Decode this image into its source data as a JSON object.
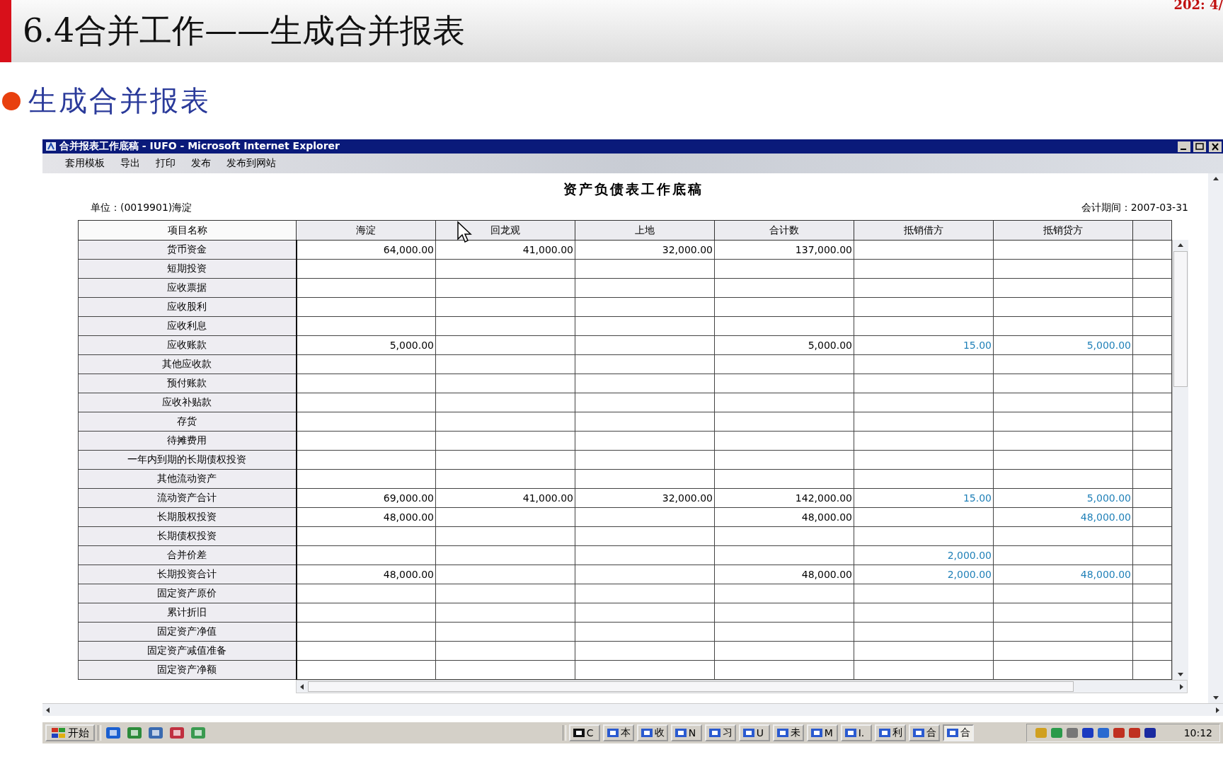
{
  "slide": {
    "title": "6.4合并工作——生成合并报表",
    "page_number": "202: 4/",
    "bullet": "生成合并报表"
  },
  "window": {
    "title": "合并报表工作底稿 - IUFO - Microsoft Internet Explorer"
  },
  "menu": [
    "套用模板",
    "导出",
    "打印",
    "发布",
    "发布到网站"
  ],
  "report": {
    "title": "资产负债表工作底稿",
    "unit": "单位：(0019901)海淀",
    "period": "会计期间：2007-03-31"
  },
  "table": {
    "name_header": "项目名称",
    "columns": [
      {
        "label": "海淀",
        "kind": "amount"
      },
      {
        "label": "回龙观",
        "kind": "amount"
      },
      {
        "label": "上地",
        "kind": "amount"
      },
      {
        "label": "合计数",
        "kind": "amount"
      },
      {
        "label": "抵销借方",
        "kind": "elimination"
      },
      {
        "label": "抵销贷方",
        "kind": "elimination"
      }
    ],
    "rows": [
      {
        "name": "货币资金",
        "cells": [
          "64,000.00",
          "41,000.00",
          "32,000.00",
          "137,000.00",
          null,
          null
        ]
      },
      {
        "name": "短期投资",
        "cells": [
          null,
          null,
          null,
          null,
          null,
          null
        ]
      },
      {
        "name": "应收票据",
        "cells": [
          null,
          null,
          null,
          null,
          null,
          null
        ]
      },
      {
        "name": "应收股利",
        "cells": [
          null,
          null,
          null,
          null,
          null,
          null
        ]
      },
      {
        "name": "应收利息",
        "cells": [
          null,
          null,
          null,
          null,
          null,
          null
        ]
      },
      {
        "name": "应收账款",
        "cells": [
          "5,000.00",
          null,
          null,
          "5,000.00",
          "15.00",
          "5,000.00"
        ]
      },
      {
        "name": "其他应收款",
        "cells": [
          null,
          null,
          null,
          null,
          null,
          null
        ]
      },
      {
        "name": "预付账款",
        "cells": [
          null,
          null,
          null,
          null,
          null,
          null
        ]
      },
      {
        "name": "应收补贴款",
        "cells": [
          null,
          null,
          null,
          null,
          null,
          null
        ]
      },
      {
        "name": "存货",
        "cells": [
          null,
          null,
          null,
          null,
          null,
          null
        ]
      },
      {
        "name": "待摊费用",
        "cells": [
          null,
          null,
          null,
          null,
          null,
          null
        ]
      },
      {
        "name": "一年内到期的长期债权投资",
        "cells": [
          null,
          null,
          null,
          null,
          null,
          null
        ]
      },
      {
        "name": "其他流动资产",
        "cells": [
          null,
          null,
          null,
          null,
          null,
          null
        ]
      },
      {
        "name": "流动资产合计",
        "cells": [
          "69,000.00",
          "41,000.00",
          "32,000.00",
          "142,000.00",
          "15.00",
          "5,000.00"
        ]
      },
      {
        "name": "长期股权投资",
        "cells": [
          "48,000.00",
          null,
          null,
          "48,000.00",
          null,
          "48,000.00"
        ]
      },
      {
        "name": "长期债权投资",
        "cells": [
          null,
          null,
          null,
          null,
          null,
          null
        ]
      },
      {
        "name": "合并价差",
        "cells": [
          null,
          null,
          null,
          null,
          "2,000.00",
          null
        ]
      },
      {
        "name": "长期投资合计",
        "cells": [
          "48,000.00",
          null,
          null,
          "48,000.00",
          "2,000.00",
          "48,000.00"
        ]
      },
      {
        "name": "固定资产原价",
        "cells": [
          null,
          null,
          null,
          null,
          null,
          null
        ]
      },
      {
        "name": "累计折旧",
        "cells": [
          null,
          null,
          null,
          null,
          null,
          null
        ]
      },
      {
        "name": "固定资产净值",
        "cells": [
          null,
          null,
          null,
          null,
          null,
          null
        ]
      },
      {
        "name": "固定资产减值准备",
        "cells": [
          null,
          null,
          null,
          null,
          null,
          null
        ]
      },
      {
        "name": "固定资产净额",
        "cells": [
          null,
          null,
          null,
          null,
          null,
          null
        ]
      }
    ]
  },
  "taskbar": {
    "start": "开始",
    "tasks": [
      {
        "label": "C",
        "selected": false
      },
      {
        "label": "本",
        "selected": false
      },
      {
        "label": "收",
        "selected": false
      },
      {
        "label": "N",
        "selected": false
      },
      {
        "label": "习",
        "selected": false
      },
      {
        "label": "U",
        "selected": false
      },
      {
        "label": "未",
        "selected": false
      },
      {
        "label": "M",
        "selected": false
      },
      {
        "label": "I.",
        "selected": false
      },
      {
        "label": "利",
        "selected": false
      },
      {
        "label": "合",
        "selected": false
      },
      {
        "label": "合",
        "selected": true
      }
    ],
    "clock": "10:12"
  }
}
